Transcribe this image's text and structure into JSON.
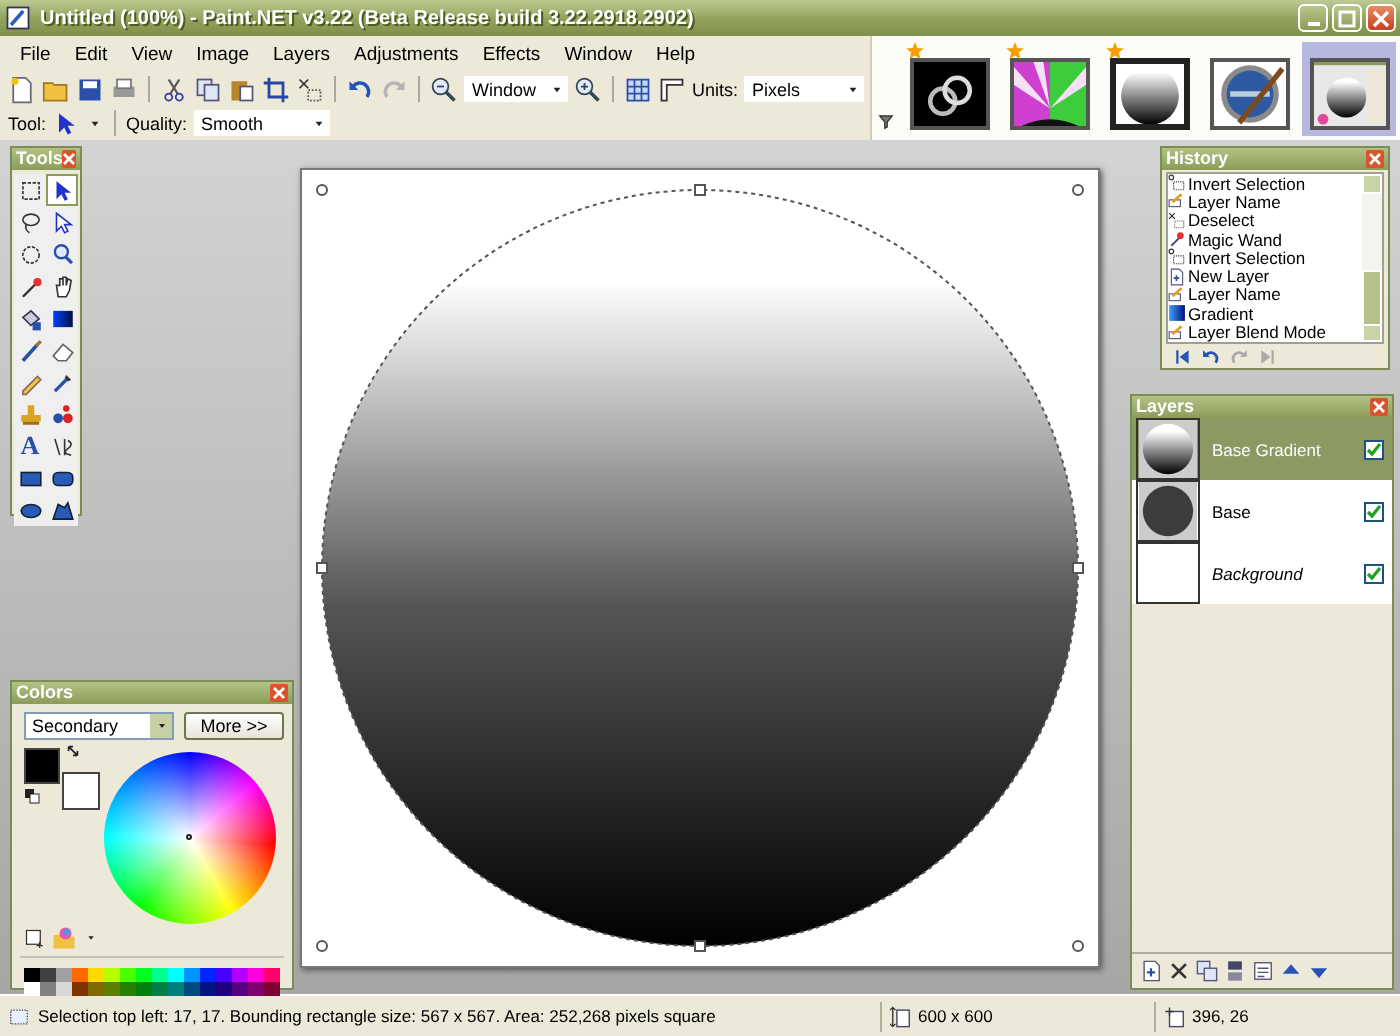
{
  "window": {
    "title": "Untitled (100%) - Paint.NET v3.22 (Beta Release build 3.22.2918.2902)"
  },
  "menu": [
    "File",
    "Edit",
    "View",
    "Image",
    "Layers",
    "Adjustments",
    "Effects",
    "Window",
    "Help"
  ],
  "toolbar": {
    "zoom": "Window",
    "units_label": "Units:",
    "units": "Pixels",
    "tool_label": "Tool:",
    "quality_label": "Quality:",
    "quality": "Smooth"
  },
  "images": [
    {
      "modified": true,
      "selected": false,
      "highlighted": false
    },
    {
      "modified": true,
      "selected": false,
      "highlighted": false
    },
    {
      "modified": true,
      "selected": true,
      "highlighted": false
    },
    {
      "modified": false,
      "selected": false,
      "highlighted": false
    },
    {
      "modified": false,
      "selected": false,
      "highlighted": true
    }
  ],
  "tools": {
    "title": "Tools",
    "items": [
      {
        "selected": false
      },
      {
        "selected": true
      },
      {
        "selected": false
      },
      {
        "selected": false
      },
      {
        "selected": false
      },
      {
        "selected": false
      },
      {
        "selected": false
      },
      {
        "selected": false
      },
      {
        "selected": false
      },
      {
        "selected": false
      },
      {
        "selected": false
      },
      {
        "selected": false
      },
      {
        "selected": false
      },
      {
        "selected": false
      },
      {
        "selected": false
      },
      {
        "selected": false
      },
      {
        "selected": false,
        "glyph": "A"
      },
      {
        "selected": false
      },
      {
        "selected": false
      },
      {
        "selected": false
      },
      {
        "selected": false
      },
      {
        "selected": false
      }
    ]
  },
  "history": {
    "title": "History",
    "items": [
      {
        "kind": "invert",
        "label": "Invert Selection"
      },
      {
        "kind": "rename",
        "label": "Layer Name"
      },
      {
        "kind": "deselect",
        "label": "Deselect"
      },
      {
        "kind": "wand",
        "label": "Magic Wand"
      },
      {
        "kind": "invert",
        "label": "Invert Selection"
      },
      {
        "kind": "new_layer",
        "label": "New Layer"
      },
      {
        "kind": "rename",
        "label": "Layer Name"
      },
      {
        "kind": "gradient",
        "label": "Gradient"
      },
      {
        "kind": "rename",
        "label": "Layer Blend Mode"
      }
    ]
  },
  "layers": {
    "title": "Layers",
    "items": [
      {
        "name": "Base Gradient",
        "kind": "gradient",
        "selected": true,
        "visible": true
      },
      {
        "name": "Base",
        "kind": "solid",
        "selected": false,
        "visible": true
      },
      {
        "name": "Background",
        "kind": "background",
        "selected": false,
        "visible": true
      }
    ]
  },
  "colors": {
    "title": "Colors",
    "mode": "Secondary",
    "more_button": "More >>",
    "primary": {
      "color": "#000000"
    },
    "secondary": {
      "color": "#ffffff"
    },
    "palette": [
      {
        "color": "#000000"
      },
      {
        "color": "#404040"
      },
      {
        "color": "#a0a0a0"
      },
      {
        "color": "#ff6a00"
      },
      {
        "color": "#ffd800"
      },
      {
        "color": "#b6ff00"
      },
      {
        "color": "#4cff00"
      },
      {
        "color": "#00ff21"
      },
      {
        "color": "#00ff90"
      },
      {
        "color": "#00ffff"
      },
      {
        "color": "#0094ff"
      },
      {
        "color": "#0026ff"
      },
      {
        "color": "#4800ff"
      },
      {
        "color": "#b200ff"
      },
      {
        "color": "#ff00dc"
      },
      {
        "color": "#ff006e"
      },
      {
        "color": "#ffffff"
      },
      {
        "color": "#808080"
      },
      {
        "color": "#d8d8d8"
      },
      {
        "color": "#7f3300"
      },
      {
        "color": "#7f6a00"
      },
      {
        "color": "#5b7f00"
      },
      {
        "color": "#267f00"
      },
      {
        "color": "#007f0e"
      },
      {
        "color": "#007f46"
      },
      {
        "color": "#007f7f"
      },
      {
        "color": "#004a7f"
      },
      {
        "color": "#00137f"
      },
      {
        "color": "#21007f"
      },
      {
        "color": "#57007f"
      },
      {
        "color": "#7f006e"
      },
      {
        "color": "#7f0037"
      }
    ]
  },
  "status_bar": {
    "selection": "Selection top left: 17, 17. Bounding rectangle size: 567 x 567. Area: 252,268 pixels square",
    "image_size": "600 x 600",
    "cursor": "396, 26"
  }
}
